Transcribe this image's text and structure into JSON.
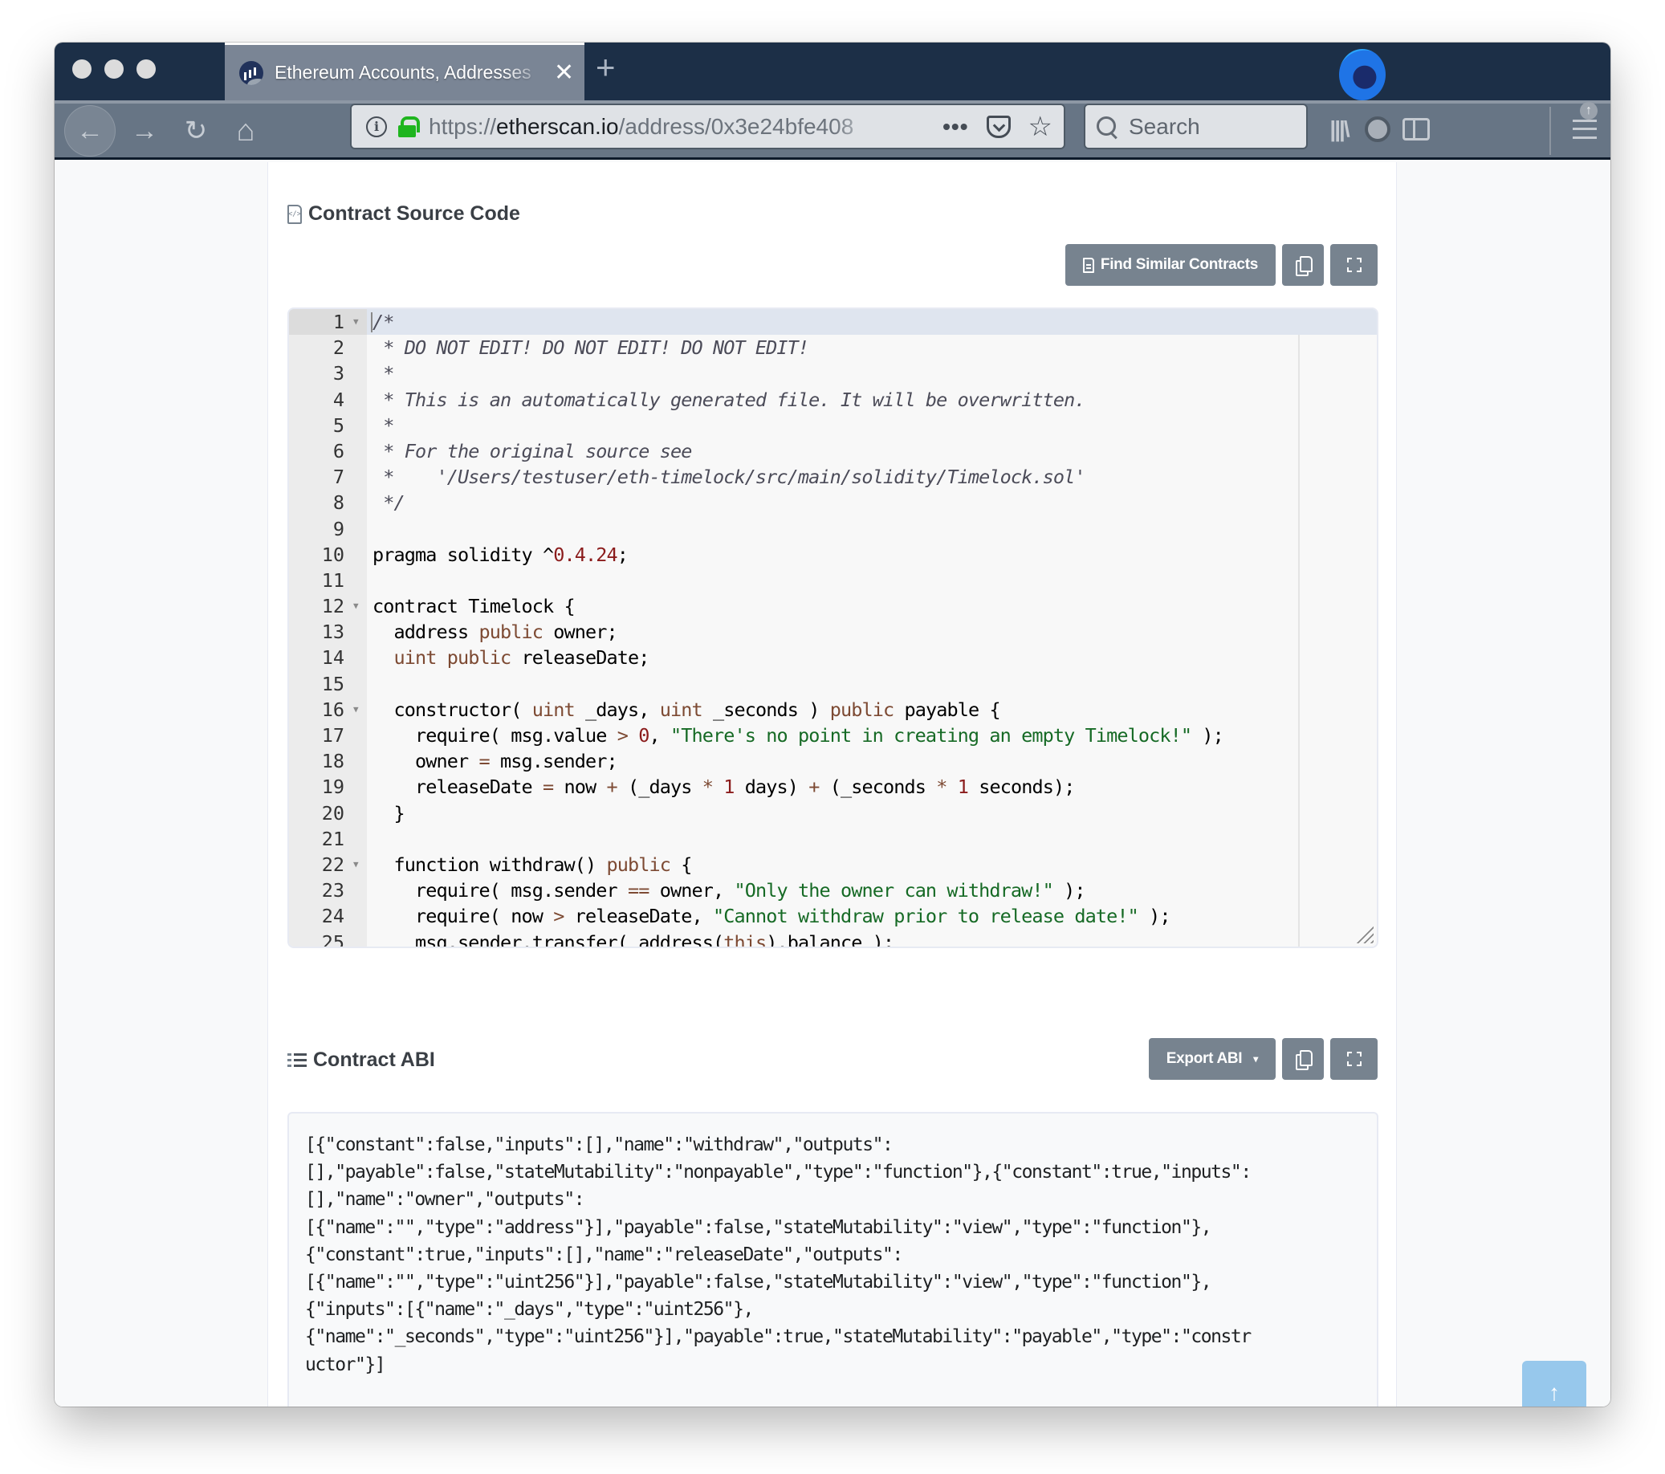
{
  "browser": {
    "tab_title": "Ethereum Accounts, Addresses",
    "tab_close": "✕",
    "new_tab": "+",
    "url_prefix": "https://",
    "url_host": "etherscan.io",
    "url_path": "/address/0x3e24bfe408",
    "url_more": "•••",
    "search_placeholder": "Search",
    "update_badge": "↑",
    "icons": {
      "back": "←",
      "forward": "→",
      "reload": "↻",
      "home": "⌂",
      "library": "|||\\",
      "star": "☆"
    }
  },
  "source_section": {
    "title": "Contract Source Code",
    "find_similar_label": "Find Similar Contracts",
    "copy_label": "",
    "fullscreen_label": ""
  },
  "source_code": {
    "lines": [
      [
        {
          "t": "com",
          "v": "/*"
        }
      ],
      [
        {
          "t": "com",
          "v": " * DO NOT EDIT! DO NOT EDIT! DO NOT EDIT!"
        }
      ],
      [
        {
          "t": "com",
          "v": " *"
        }
      ],
      [
        {
          "t": "com",
          "v": " * This is an automatically generated file. It will be overwritten."
        }
      ],
      [
        {
          "t": "com",
          "v": " *"
        }
      ],
      [
        {
          "t": "com",
          "v": " * For the original source see"
        }
      ],
      [
        {
          "t": "com",
          "v": " *    '/Users/testuser/eth-timelock/src/main/solidity/Timelock.sol'"
        }
      ],
      [
        {
          "t": "com",
          "v": " */"
        }
      ],
      [],
      [
        {
          "t": "",
          "v": "pragma solidity ^"
        },
        {
          "t": "num",
          "v": "0.4.24"
        },
        {
          "t": "",
          "v": ";"
        }
      ],
      [],
      [
        {
          "t": "",
          "v": "contract Timelock {"
        }
      ],
      [
        {
          "t": "",
          "v": "  address "
        },
        {
          "t": "kw",
          "v": "public"
        },
        {
          "t": "",
          "v": " owner;"
        }
      ],
      [
        {
          "t": "",
          "v": "  "
        },
        {
          "t": "kw",
          "v": "uint"
        },
        {
          "t": "",
          "v": " "
        },
        {
          "t": "kw",
          "v": "public"
        },
        {
          "t": "",
          "v": " releaseDate;"
        }
      ],
      [],
      [
        {
          "t": "",
          "v": "  constructor( "
        },
        {
          "t": "kw",
          "v": "uint"
        },
        {
          "t": "",
          "v": " _days, "
        },
        {
          "t": "kw",
          "v": "uint"
        },
        {
          "t": "",
          "v": " _seconds ) "
        },
        {
          "t": "kw",
          "v": "public"
        },
        {
          "t": "",
          "v": " payable {"
        }
      ],
      [
        {
          "t": "",
          "v": "    require( msg.value "
        },
        {
          "t": "op",
          "v": ">"
        },
        {
          "t": "",
          "v": " "
        },
        {
          "t": "num",
          "v": "0"
        },
        {
          "t": "",
          "v": ", "
        },
        {
          "t": "str",
          "v": "\"There's no point in creating an empty Timelock!\""
        },
        {
          "t": "",
          "v": " );"
        }
      ],
      [
        {
          "t": "",
          "v": "    owner "
        },
        {
          "t": "op",
          "v": "="
        },
        {
          "t": "",
          "v": " msg.sender;"
        }
      ],
      [
        {
          "t": "",
          "v": "    releaseDate "
        },
        {
          "t": "op",
          "v": "="
        },
        {
          "t": "",
          "v": " now "
        },
        {
          "t": "op",
          "v": "+"
        },
        {
          "t": "",
          "v": " (_days "
        },
        {
          "t": "op",
          "v": "*"
        },
        {
          "t": "",
          "v": " "
        },
        {
          "t": "num",
          "v": "1"
        },
        {
          "t": "",
          "v": " days) "
        },
        {
          "t": "op",
          "v": "+"
        },
        {
          "t": "",
          "v": " (_seconds "
        },
        {
          "t": "op",
          "v": "*"
        },
        {
          "t": "",
          "v": " "
        },
        {
          "t": "num",
          "v": "1"
        },
        {
          "t": "",
          "v": " seconds);"
        }
      ],
      [
        {
          "t": "",
          "v": "  }"
        }
      ],
      [],
      [
        {
          "t": "",
          "v": "  function withdraw() "
        },
        {
          "t": "kw",
          "v": "public"
        },
        {
          "t": "",
          "v": " {"
        }
      ],
      [
        {
          "t": "",
          "v": "    require( msg.sender "
        },
        {
          "t": "op",
          "v": "=="
        },
        {
          "t": "",
          "v": " owner, "
        },
        {
          "t": "str",
          "v": "\"Only the owner can withdraw!\""
        },
        {
          "t": "",
          "v": " );"
        }
      ],
      [
        {
          "t": "",
          "v": "    require( now "
        },
        {
          "t": "op",
          "v": ">"
        },
        {
          "t": "",
          "v": " releaseDate, "
        },
        {
          "t": "str",
          "v": "\"Cannot withdraw prior to release date!\""
        },
        {
          "t": "",
          "v": " );"
        }
      ],
      [
        {
          "t": "",
          "v": "    msg.sender.transfer( address("
        },
        {
          "t": "kw",
          "v": "this"
        },
        {
          "t": "",
          "v": ").balance );"
        }
      ]
    ],
    "foldable_lines": [
      1,
      12,
      16,
      22
    ],
    "active_line": 1
  },
  "abi_section": {
    "title": "Contract ABI",
    "export_label": "Export ABI",
    "abi_text": "[{\"constant\":false,\"inputs\":[],\"name\":\"withdraw\",\"outputs\":[],\"payable\":false,\"stateMutability\":\"nonpayable\",\"type\":\"function\"},{\"constant\":true,\"inputs\":[],\"name\":\"owner\",\"outputs\":[{\"name\":\"\",\"type\":\"address\"}],\"payable\":false,\"stateMutability\":\"view\",\"type\":\"function\"},{\"constant\":true,\"inputs\":[],\"name\":\"releaseDate\",\"outputs\":[{\"name\":\"\",\"type\":\"uint256\"}],\"payable\":false,\"stateMutability\":\"view\",\"type\":\"function\"},{\"inputs\":[{\"name\":\"_days\",\"type\":\"uint256\"},{\"name\":\"_seconds\",\"type\":\"uint256\"}],\"payable\":true,\"stateMutability\":\"payable\",\"type\":\"constructor\"}]",
    "abi_lines": [
      "[{\"constant\":false,\"inputs\":[],\"name\":\"withdraw\",\"outputs\":",
      "[],\"payable\":false,\"stateMutability\":\"nonpayable\",\"type\":\"function\"},{\"constant\":true,\"inputs\":",
      "[],\"name\":\"owner\",\"outputs\":",
      "[{\"name\":\"\",\"type\":\"address\"}],\"payable\":false,\"stateMutability\":\"view\",\"type\":\"function\"},",
      "{\"constant\":true,\"inputs\":[],\"name\":\"releaseDate\",\"outputs\":",
      "[{\"name\":\"\",\"type\":\"uint256\"}],\"payable\":false,\"stateMutability\":\"view\",\"type\":\"function\"},",
      "{\"inputs\":[{\"name\":\"_days\",\"type\":\"uint256\"},",
      "{\"name\":\"_seconds\",\"type\":\"uint256\"}],\"payable\":true,\"stateMutability\":\"payable\",\"type\":\"constr",
      "uctor\"}]"
    ]
  },
  "back_to_top": "↑",
  "colors": {
    "button_bg": "#77838f",
    "back_to_top_bg": "#97c8ec",
    "string": "#166a25",
    "keyword": "#7d4a33",
    "number": "#8b1c1c"
  }
}
